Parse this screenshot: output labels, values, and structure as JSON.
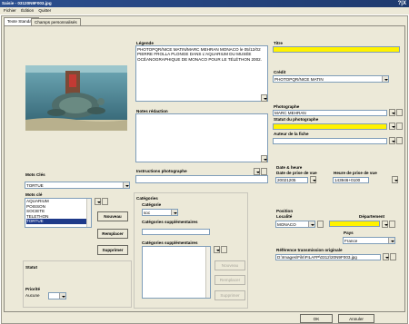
{
  "window": {
    "title": "Saisie - 03120N9F003.jpg",
    "close_label": "?|X"
  },
  "menu": [
    "Fichier",
    "Édition",
    "Quitter"
  ],
  "tabs": [
    {
      "label": "Texte Standard"
    },
    {
      "label": "Champs personnalisés"
    }
  ],
  "legende": {
    "label": "Légende",
    "text": "PHOTOPQR/NICE MATIN/MARC MEHRAN MONACO le 05/12/02 PIERRE FROLLA PLONGE DANS L'AQUARIUM DU MUSÉE OCÉANOGRAPHIQUE DE MONACO POUR LE TÉLÉTHON 2002."
  },
  "notes_redaction": {
    "label": "Notes rédaction",
    "text": ""
  },
  "instructions": {
    "label": "Instructions photographe",
    "text": ""
  },
  "titre": {
    "label": "Titre",
    "value": ""
  },
  "credit": {
    "label": "Crédit",
    "value": "PHOTOPQR/NICE MATIN"
  },
  "photographe": {
    "label": "Photographe",
    "value": "MARC MEHRAN"
  },
  "statut_photographe": {
    "label": "Statut du photographe",
    "value": ""
  },
  "auteur_fiche": {
    "label": "Auteur de la fiche",
    "value": ""
  },
  "date_heure": {
    "label": "Date & heure",
    "date_label": "Date de prise de vue",
    "date_value": "20021205",
    "heure_label": "Heure de prise de vue",
    "heure_value": "143946+0100"
  },
  "position": {
    "label": "Position",
    "localite_label": "Localité",
    "localite_value": "MONACO",
    "departement_label": "Département",
    "departement_value": "",
    "pays_label": "Pays",
    "pays_value": "France",
    "reference_label": "Référence transmission originale",
    "reference_value": "D:\\Images\\Fils\\FILAFP\\0312\\20N9F003.jpg"
  },
  "mots_cles": {
    "label": "Mots Clés",
    "value": "TORTUE",
    "list_label": "Mots clé",
    "items": [
      "AQUARIUM",
      "POISSON",
      "SOCIETE",
      "TELETHON",
      "TORTUE"
    ],
    "selected": "TORTUE",
    "buttons": {
      "nouveau": "Nouveau",
      "remplacer": "Remplacer",
      "supprimer": "Supprimer"
    }
  },
  "categories": {
    "label": "Catégories",
    "category_label": "Catégorie",
    "category_value": "soc",
    "supp_label": "Catégories supplémentaires",
    "supp_value": "",
    "supp_list_label": "Catégories supplémentaires",
    "buttons": {
      "nouveau": "Nouveau",
      "remplacer": "Remplacer",
      "supprimer": "Supprimer"
    }
  },
  "statut": {
    "label": "Statut"
  },
  "priorite": {
    "label": "Priorité",
    "value": "Aucune"
  },
  "footer": {
    "ok": "OK",
    "annuler": "Annuler"
  }
}
